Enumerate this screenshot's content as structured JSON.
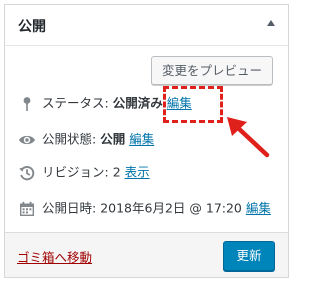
{
  "panel": {
    "title": "公開"
  },
  "preview_button": "変更をプレビュー",
  "status": {
    "label": "ステータス:",
    "value": "公開済み",
    "edit": "編集"
  },
  "visibility": {
    "label": "公開状態:",
    "value": "公開",
    "edit": "編集"
  },
  "revisions": {
    "label": "リビジョン:",
    "value": "2",
    "link": "表示"
  },
  "published": {
    "label": "公開日時:",
    "value": "2018年6月2日 @ 17:20",
    "edit": "編集"
  },
  "footer": {
    "trash_link": "ゴミ箱へ移動",
    "publish_button": "更新"
  },
  "icons": {
    "status": "pin-icon",
    "visibility": "eye-icon",
    "revisions": "history-icon",
    "published": "calendar-icon",
    "toggle": "triangle-up-icon"
  },
  "colors": {
    "link": "#0073aa",
    "trash": "#a00000",
    "primary_button": "#0085ba",
    "annotation": "#e0201b",
    "icon": "#82878c"
  }
}
